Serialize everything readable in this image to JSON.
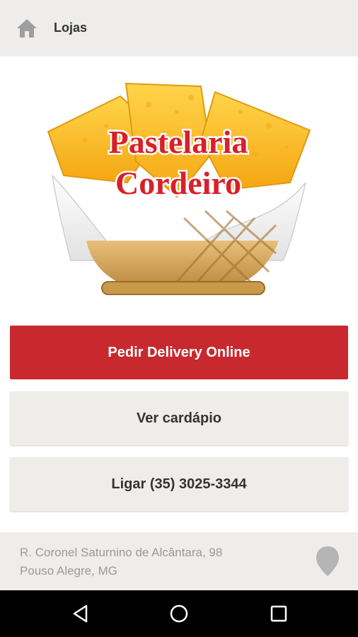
{
  "topbar": {
    "title": "Lojas",
    "home_icon": "home-icon"
  },
  "logo": {
    "line1": "Pastelaria",
    "line2": "Cordeiro"
  },
  "actions": {
    "delivery_label": "Pedir Delivery Online",
    "menu_label": "Ver cardápio",
    "call_label": "Ligar (35) 3025-3344"
  },
  "address": {
    "line1": "R. Coronel Saturnino de Alcântara, 98",
    "line2": "Pouso Alegre, MG",
    "pin_icon": "map-pin-icon"
  },
  "navbar": {
    "back_icon": "back-triangle-icon",
    "home_icon": "home-circle-icon",
    "recent_icon": "recent-apps-icon"
  },
  "colors": {
    "primary": "#c8292e",
    "bar_bg": "#eeedeb",
    "button_bg": "#efedea",
    "text_dark": "#333333",
    "text_muted": "#9a9a9a"
  }
}
